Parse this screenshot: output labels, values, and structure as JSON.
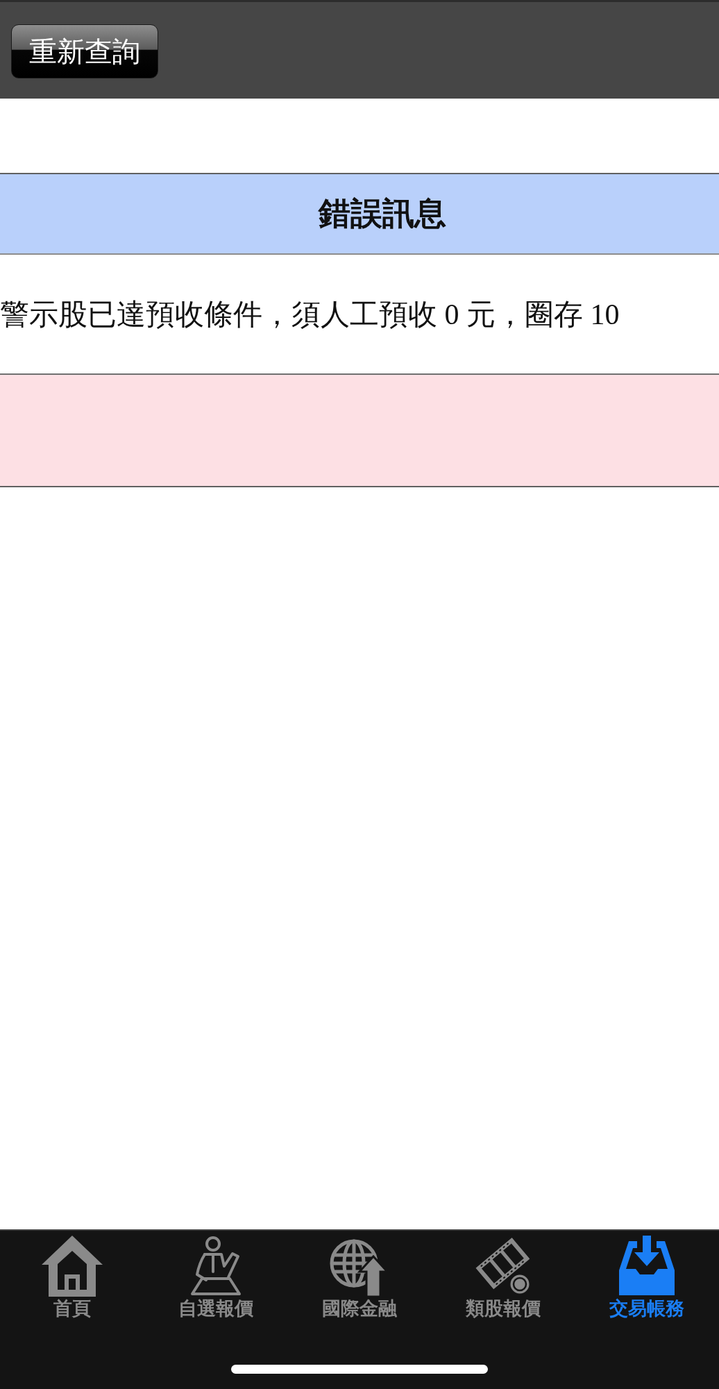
{
  "toolbar": {
    "button": "重新查詢"
  },
  "error_table": {
    "title": "錯誤訊息",
    "message": "警示股已達預收條件，須人工預收 0 元，圈存 10"
  },
  "tab_bar": {
    "tabs": [
      {
        "label": "首頁",
        "kind": "home",
        "selected": false
      },
      {
        "label": "自選報價",
        "kind": "watchlist",
        "selected": false
      },
      {
        "label": "國際金融",
        "kind": "global",
        "selected": false
      },
      {
        "label": "類股報價",
        "kind": "sector",
        "selected": false
      },
      {
        "label": "交易帳務",
        "kind": "account",
        "selected": true
      }
    ]
  }
}
